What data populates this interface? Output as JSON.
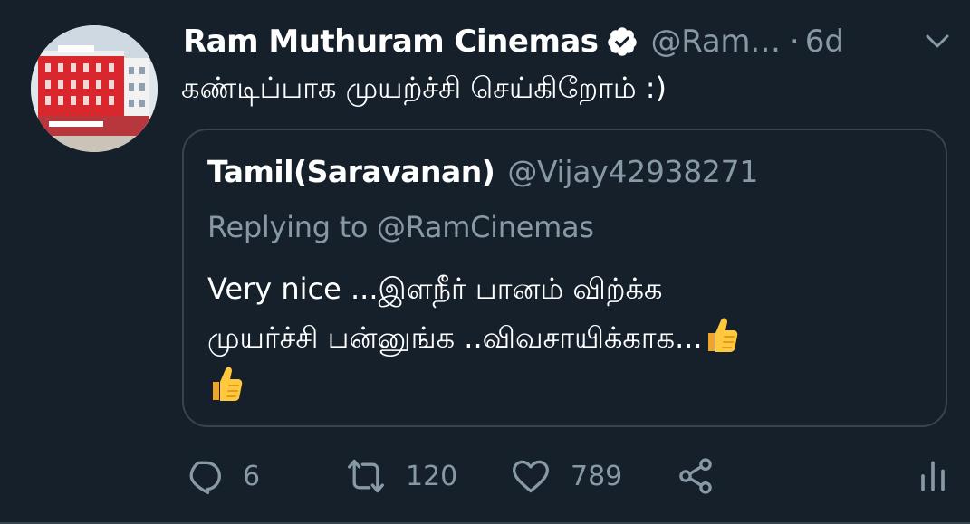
{
  "tweet": {
    "author_name": "Ram Muthuram Cinemas",
    "author_handle": "@Ram…",
    "separator": "·",
    "time": "6d",
    "text": "கண்டிப்பாக முயற்ச்சி செய்கிறோம் :)",
    "verified_icon": "verified-badge-icon",
    "avatar_icon": "cinema-building-photo",
    "menu_icon": "chevron-down-icon"
  },
  "quoted_tweet": {
    "author_name": "Tamil(Saravanan)",
    "author_handle": "@Vijay42938271",
    "replying_prefix": "Replying to ",
    "replying_to": "@RamCinemas",
    "body_line1": "Very nice ...இளநீர் பானம் விற்க்க",
    "body_line2": "முயர்ச்சி பன்னுங்க ..விவசாயிக்காக...",
    "emoji": "thumbs-up"
  },
  "actions": {
    "reply_count": "6",
    "retweet_count": "120",
    "like_count": "789",
    "icons": [
      "reply-icon",
      "retweet-icon",
      "like-icon",
      "share-icon",
      "analytics-icon"
    ]
  },
  "colors": {
    "background": "#15202b",
    "border": "#38444d",
    "secondary_text": "#8899a6",
    "primary_text": "#ffffff",
    "thumb": "#ffc83d"
  }
}
